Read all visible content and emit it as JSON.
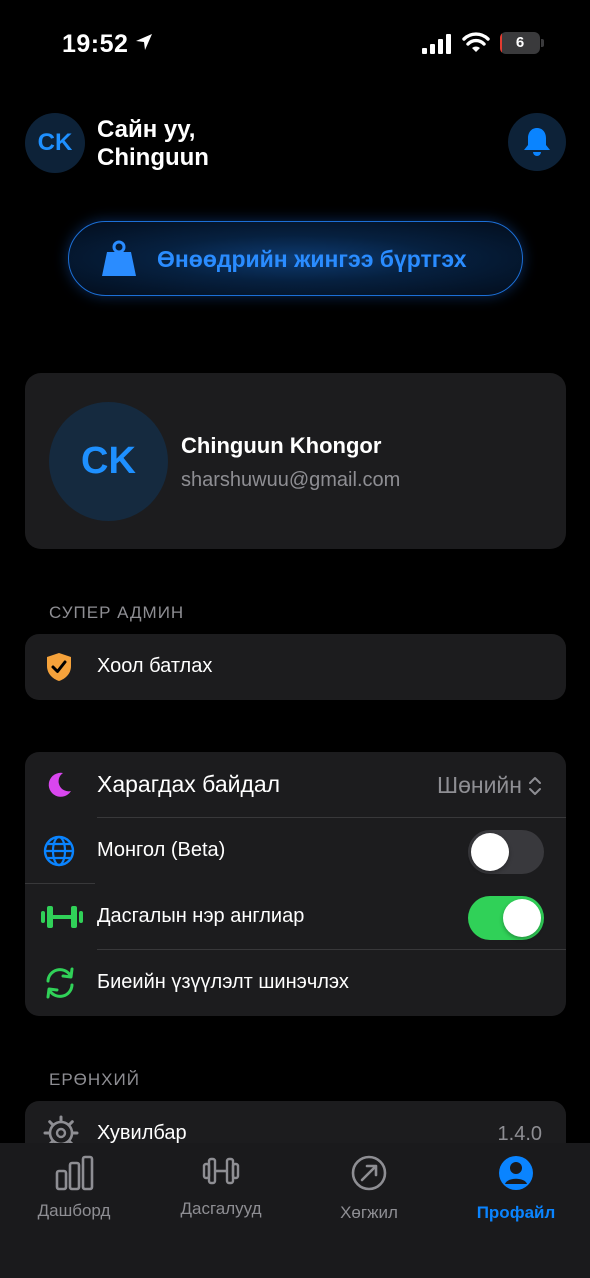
{
  "status_bar": {
    "time": "19:52",
    "battery": "6",
    "battery_level": 0.06
  },
  "header": {
    "avatar_initials": "CK",
    "greeting_line1": "Сайн уу,",
    "greeting_line2": "Chinguun"
  },
  "weight_button": {
    "label": "Өнөөдрийн жингээ бүртгэх"
  },
  "profile": {
    "initials": "CK",
    "name": "Chinguun Khongor",
    "email": "sharshuwuu@gmail.com"
  },
  "super_admin": {
    "title": "СУПЕР АДМИН",
    "item_label": "Хоол батлах"
  },
  "settings": {
    "appearance_label": "Харагдах байдал",
    "appearance_value": "Шөнийн",
    "mongolian_label": "Монгол (Beta)",
    "mongolian_on": false,
    "exercise_english_label": "Дасгалын нэр англиар",
    "exercise_english_on": true,
    "refresh_label": "Биеийн үзүүлэлт шинэчлэх"
  },
  "general": {
    "title": "ЕРӨНХИЙ",
    "version_label": "Хувилбар",
    "version_value": "1.4.0"
  },
  "tabs": [
    {
      "label": "Дашборд",
      "icon": "bar-chart-icon",
      "active": false
    },
    {
      "label": "Дасгалууд",
      "icon": "dumbbell-icon",
      "active": false
    },
    {
      "label": "Хөгжил",
      "icon": "progress-arrow-icon",
      "active": false
    },
    {
      "label": "Профайл",
      "icon": "person-icon",
      "active": true
    }
  ],
  "colors": {
    "accent": "#0a84ff",
    "toggle_on": "#30d158",
    "card": "#1c1c1e",
    "shield": "#f5a23b",
    "moon": "#d946ef"
  }
}
